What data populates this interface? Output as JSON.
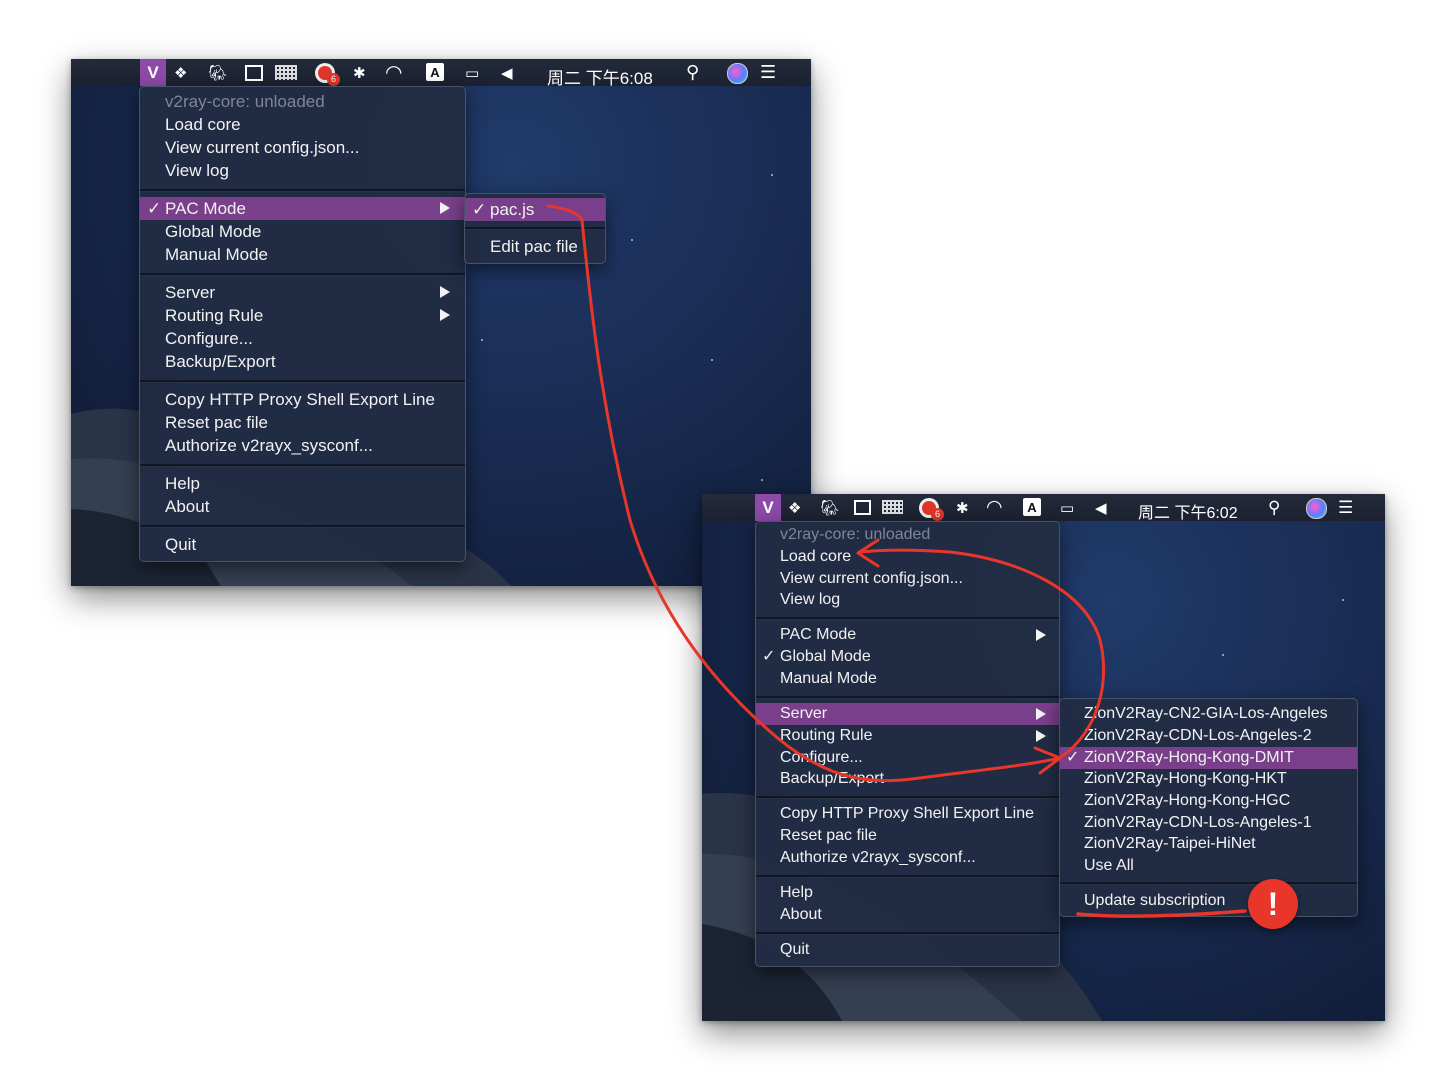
{
  "screenshot1": {
    "menubar": {
      "clock": "周二 下午6:08",
      "app_icon": "V",
      "badge_count": "6",
      "input_source": "A"
    },
    "main_menu": {
      "status": "v2ray-core: unloaded",
      "load_core": "Load core",
      "view_config": "View current config.json...",
      "view_log": "View log",
      "pac_mode": "PAC Mode",
      "global_mode": "Global Mode",
      "manual_mode": "Manual Mode",
      "server": "Server",
      "routing_rule": "Routing Rule",
      "configure": "Configure...",
      "backup_export": "Backup/Export",
      "copy_proxy": "Copy HTTP Proxy Shell Export Line",
      "reset_pac": "Reset pac file",
      "authorize": "Authorize v2rayx_sysconf...",
      "help": "Help",
      "about": "About",
      "quit": "Quit",
      "check": "✓"
    },
    "pac_submenu": {
      "pac_js": "pac.js",
      "edit_pac": "Edit pac file",
      "check": "✓"
    }
  },
  "screenshot2": {
    "menubar": {
      "clock": "周二 下午6:02",
      "app_icon": "V",
      "badge_count": "6",
      "input_source": "A"
    },
    "main_menu": {
      "status": "v2ray-core: unloaded",
      "load_core": "Load core",
      "view_config": "View current config.json...",
      "view_log": "View log",
      "pac_mode": "PAC Mode",
      "global_mode": "Global Mode",
      "manual_mode": "Manual Mode",
      "server": "Server",
      "routing_rule": "Routing Rule",
      "configure": "Configure...",
      "backup_export": "Backup/Export",
      "copy_proxy": "Copy HTTP Proxy Shell Export Line",
      "reset_pac": "Reset pac file",
      "authorize": "Authorize v2rayx_sysconf...",
      "help": "Help",
      "about": "About",
      "quit": "Quit",
      "check": "✓"
    },
    "server_submenu": {
      "servers": [
        "ZionV2Ray-CN2-GIA-Los-Angeles",
        "ZionV2Ray-CDN-Los-Angeles-2",
        "ZionV2Ray-Hong-Kong-DMIT",
        "ZionV2Ray-Hong-Kong-HKT",
        "ZionV2Ray-Hong-Kong-HGC",
        "ZionV2Ray-CDN-Los-Angeles-1",
        "ZionV2Ray-Taipei-HiNet"
      ],
      "use_all": "Use All",
      "update_subscription": "Update subscription",
      "check": "✓"
    }
  },
  "annotation": {
    "warning_mark": "!",
    "accent_color": "#e8362a",
    "highlight_color": "#7a3f8a"
  }
}
